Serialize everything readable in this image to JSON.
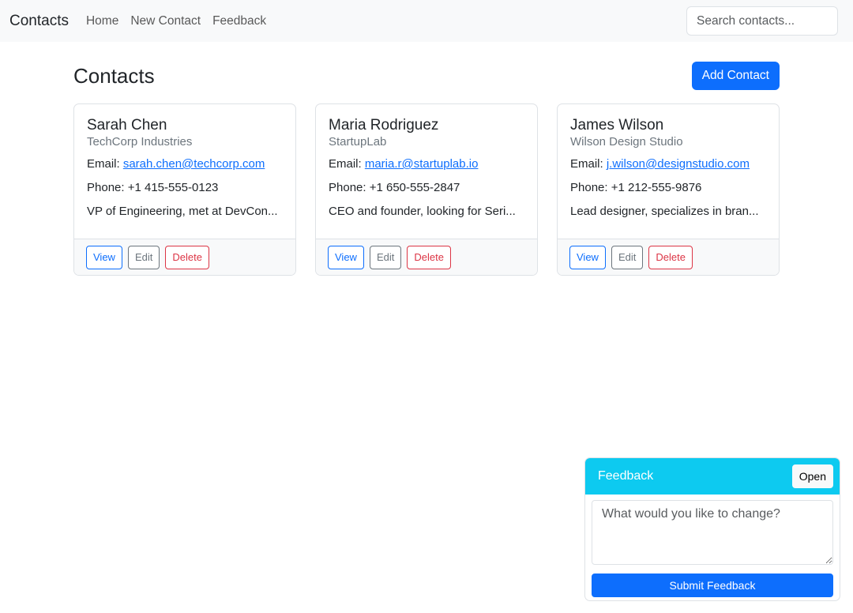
{
  "navbar": {
    "brand": "Contacts",
    "links": [
      "Home",
      "New Contact",
      "Feedback"
    ],
    "search_placeholder": "Search contacts..."
  },
  "page": {
    "title": "Contacts",
    "add_button": "Add Contact"
  },
  "contacts": [
    {
      "name": "Sarah Chen",
      "company": "TechCorp Industries",
      "email_label": "Email: ",
      "email": "sarah.chen@techcorp.com",
      "phone": "Phone: +1 415-555-0123",
      "note": "VP of Engineering, met at DevCon..."
    },
    {
      "name": "Maria Rodriguez",
      "company": "StartupLab",
      "email_label": "Email: ",
      "email": "maria.r@startuplab.io",
      "phone": "Phone: +1 650-555-2847",
      "note": "CEO and founder, looking for Seri..."
    },
    {
      "name": "James Wilson",
      "company": "Wilson Design Studio",
      "email_label": "Email: ",
      "email": "j.wilson@designstudio.com",
      "phone": "Phone: +1 212-555-9876",
      "note": "Lead designer, specializes in bran..."
    }
  ],
  "card_actions": {
    "view": "View",
    "edit": "Edit",
    "delete": "Delete"
  },
  "feedback": {
    "title": "Feedback",
    "open_button": "Open",
    "placeholder": "What would you like to change?",
    "submit": "Submit Feedback"
  },
  "colors": {
    "primary": "#0d6efd",
    "info": "#0dcaf0",
    "danger": "#dc3545",
    "secondary": "#6c757d"
  }
}
